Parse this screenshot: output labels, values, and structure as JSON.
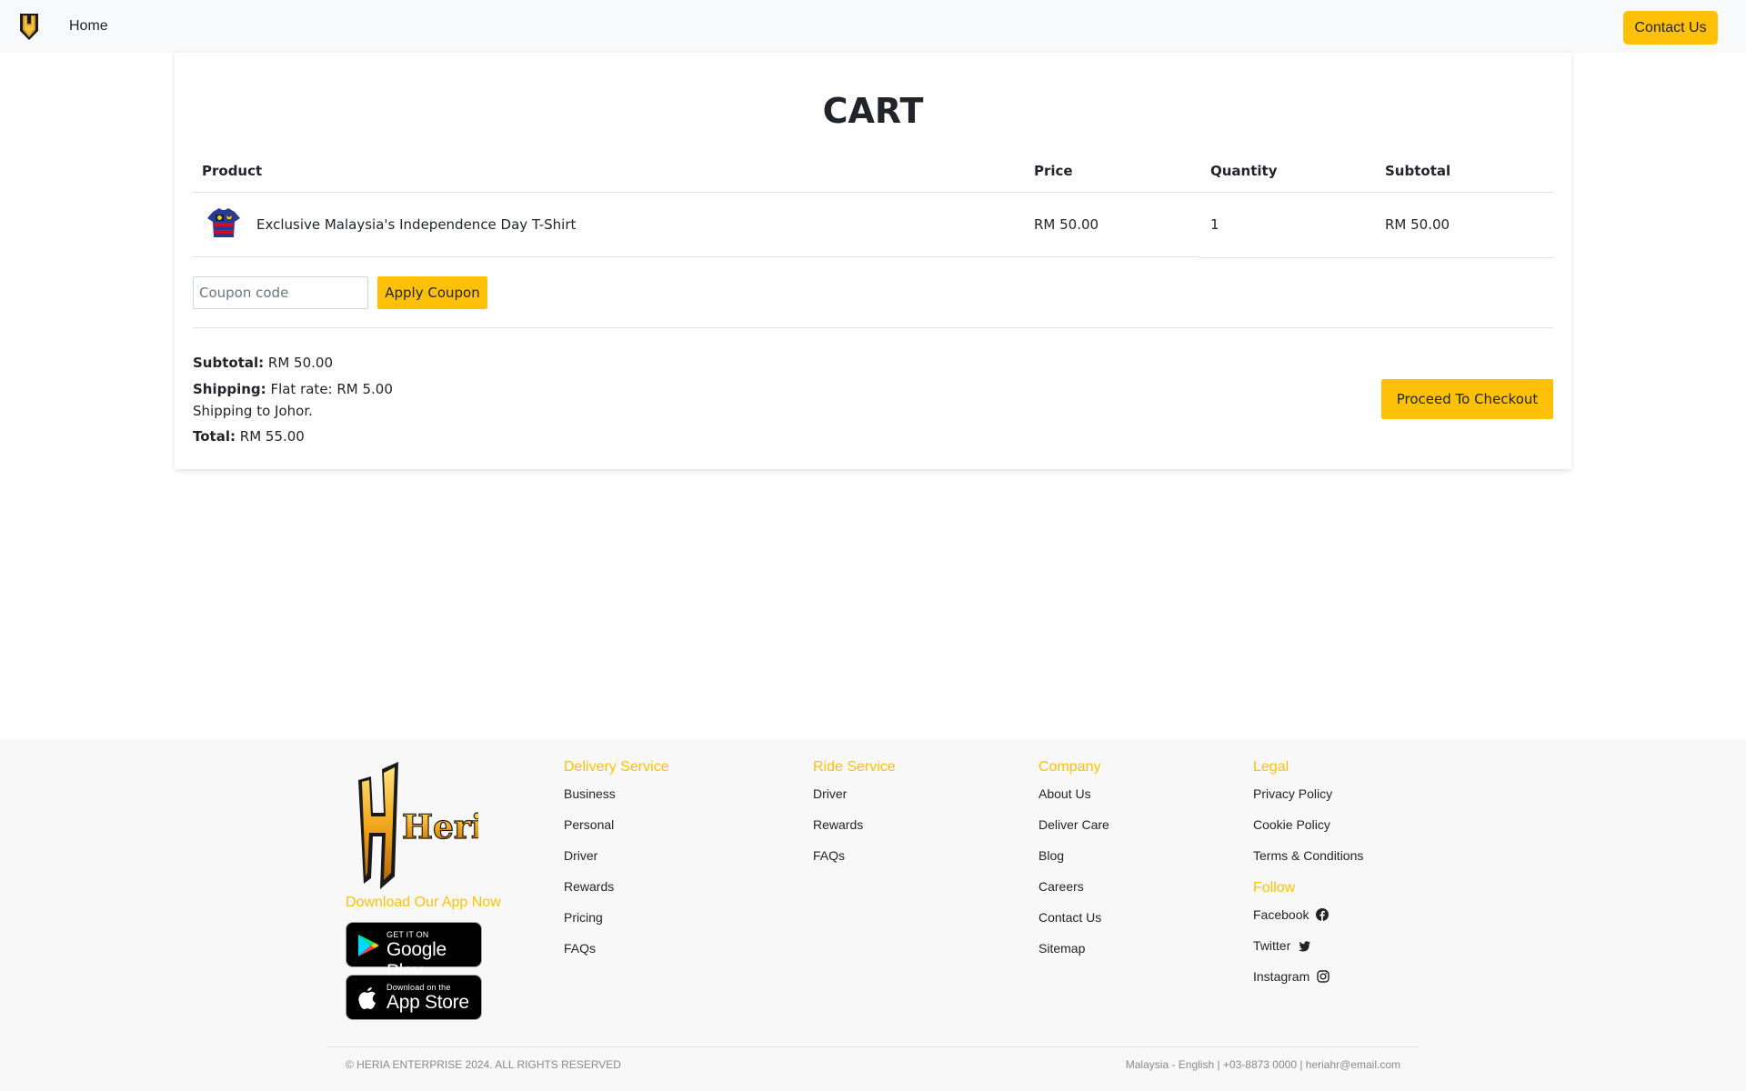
{
  "nav": {
    "logo_icon": "heria-shield-icon",
    "home_label": "Home",
    "contact_label": "Contact Us"
  },
  "cart": {
    "title": "CART",
    "headers": {
      "product": "Product",
      "price": "Price",
      "quantity": "Quantity",
      "subtotal": "Subtotal"
    },
    "items": [
      {
        "image_icon": "tshirt-thumbnail",
        "name": "Exclusive Malaysia's Independence Day T-Shirt",
        "price": "RM 50.00",
        "quantity": "1",
        "subtotal": "RM 50.00"
      }
    ],
    "coupon_placeholder": "Coupon code",
    "apply_label": "Apply Coupon",
    "summary": {
      "subtotal_label": "Subtotal:",
      "subtotal_value": "RM 50.00",
      "shipping_label": "Shipping:",
      "shipping_value": "Flat rate: RM 5.00",
      "shipping_note": "Shipping to Johor.",
      "total_label": "Total:",
      "total_value": "RM 55.00"
    },
    "checkout_label": "Proceed To Checkout"
  },
  "footer": {
    "logo_text": "Heria",
    "download_label": "Download Our App Now",
    "google_play": {
      "small": "GET IT ON",
      "big": "Google Play"
    },
    "app_store": {
      "small": "Download on the",
      "big": "App Store"
    },
    "columns": {
      "delivery": {
        "heading": "Delivery Service",
        "links": [
          "Business",
          "Personal",
          "Driver",
          "Rewards",
          "Pricing",
          "FAQs"
        ]
      },
      "ride": {
        "heading": "Ride Service",
        "links": [
          "Driver",
          "Rewards",
          "FAQs"
        ]
      },
      "company": {
        "heading": "Company",
        "links": [
          "About Us",
          "Deliver Care",
          "Blog",
          "Careers",
          "Contact Us",
          "Sitemap"
        ]
      },
      "legal": {
        "heading": "Legal",
        "links": [
          "Privacy Policy",
          "Cookie Policy",
          "Terms & Conditions"
        ]
      },
      "follow": {
        "heading": "Follow",
        "links": [
          "Facebook",
          "Twitter",
          "Instagram"
        ]
      }
    },
    "copyright": "© HERIA ENTERPRISE 2024. ALL RIGHTS RESERVED",
    "contact_info": "Malaysia - English | +03-8873 0000 | heriahr@email.com"
  },
  "colors": {
    "accent": "#ffc107",
    "nav_bg": "#f8f9fa",
    "footer_bg": "#f8f8f8",
    "text": "#212529"
  }
}
